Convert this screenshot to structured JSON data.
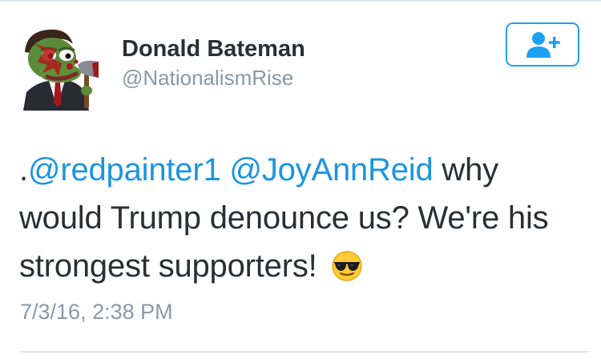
{
  "tweet": {
    "author": {
      "display_name": "Donald Bateman",
      "handle": "@NationalismRise",
      "avatar_icon": "pepe-with-axe-avatar"
    },
    "follow_button": {
      "icon": "add-user-icon",
      "color": "#1da1f2"
    },
    "text": {
      "prefix": ".",
      "mention_1": "@redpainter1",
      "space": " ",
      "mention_2": "@JoyAnnReid",
      "body": " why would Trump denounce us? We're his strongest supporters! ",
      "emoji": "smiling-face-with-sunglasses"
    },
    "timestamp": "7/3/16, 2:38 PM",
    "colors": {
      "text": "#292f33",
      "mention": "#1b95e0",
      "secondary": "#8899a6"
    }
  }
}
